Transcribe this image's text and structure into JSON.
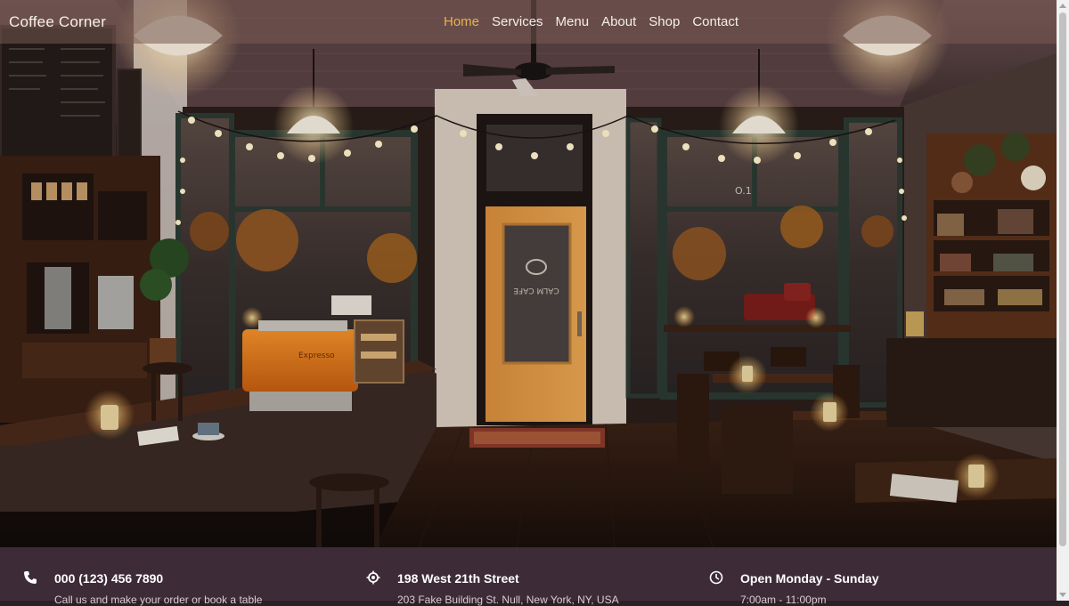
{
  "brand": {
    "name": "Coffee Corner"
  },
  "nav": {
    "items": [
      {
        "label": "Home",
        "active": true
      },
      {
        "label": "Services",
        "active": false
      },
      {
        "label": "Menu",
        "active": false
      },
      {
        "label": "About",
        "active": false
      },
      {
        "label": "Shop",
        "active": false
      },
      {
        "label": "Contact",
        "active": false
      }
    ]
  },
  "hero": {
    "door_sign": "CALM CAFE",
    "window_number": "O.1",
    "espresso_brand": "Expresso"
  },
  "info": [
    {
      "icon": "phone-icon",
      "title": "000 (123) 456 7890",
      "sub": "Call us and make your order or book a table"
    },
    {
      "icon": "location-icon",
      "title": "198 West 21th Street",
      "sub": "203 Fake Building St. Null, New York, NY, USA"
    },
    {
      "icon": "clock-icon",
      "title": "Open Monday - Sunday",
      "sub": "7:00am - 11:00pm"
    }
  ],
  "colors": {
    "accent": "#e8b24a",
    "info_bar": "#3d2c38",
    "navbar": "#785a52"
  }
}
